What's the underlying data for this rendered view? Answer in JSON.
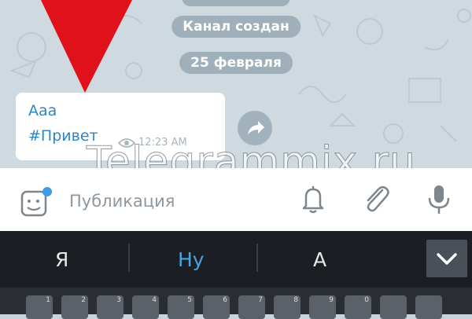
{
  "chat": {
    "service_messages": [
      "Канал создан",
      "25 февраля"
    ],
    "message": {
      "title": "Ааа",
      "hashtag": "#Привет",
      "time": "12:23 AM"
    },
    "watermark": "Telegrammix.ru"
  },
  "composer": {
    "placeholder": "Публикация",
    "icons": [
      "sticker-icon",
      "bell-icon",
      "paperclip-icon",
      "microphone-icon"
    ]
  },
  "keyboard": {
    "suggestions": [
      "Я",
      "Ну",
      "А"
    ],
    "key_hints": [
      "1",
      "2",
      "3",
      "4",
      "5",
      "6",
      "7",
      "8",
      "9",
      "0"
    ]
  },
  "colors": {
    "accent": "#2e86c7",
    "arrow": "#e0111a",
    "suggestion_highlight": "#4aa3e0"
  }
}
